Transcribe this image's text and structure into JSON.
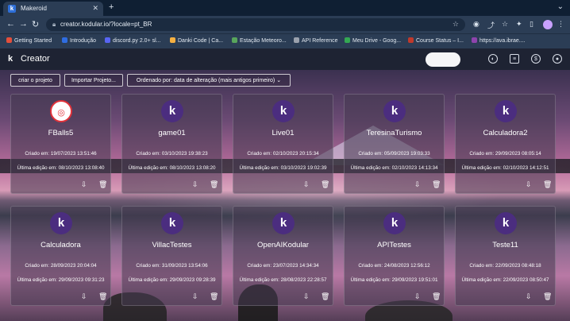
{
  "browser": {
    "tab_title": "Makeroid",
    "url": "creator.kodular.io/?locale=pt_BR",
    "bookmarks": [
      {
        "label": "Getting Started",
        "color": "#e34f3b"
      },
      {
        "label": "Introdução",
        "color": "#2f6de1"
      },
      {
        "label": "discord.py 2.0+ sl...",
        "color": "#5865f2"
      },
      {
        "label": "Danki Code | Ca...",
        "color": "#f5b041"
      },
      {
        "label": "Estação Meteoro...",
        "color": "#58a55c"
      },
      {
        "label": "API Reference",
        "color": "#9aa1ad"
      },
      {
        "label": "Meu Drive - Goog...",
        "color": "#34a853"
      },
      {
        "label": "Course Status – I...",
        "color": "#c0392b"
      },
      {
        "label": "https://ava.ibrae....",
        "color": "#8e44ad"
      }
    ]
  },
  "app": {
    "logo": "k",
    "title": "Creator"
  },
  "toolbar": {
    "create_label": "criar o projeto",
    "import_label": "Importar Projeto...",
    "sort_label": "Ordenado por: data de alteração (mais antigos primeiro)"
  },
  "projects": [
    {
      "name": "FBalls5",
      "created": "Criado em: 19/07/2023 13:51:46",
      "edited": "Última edição em: 08/10/2023 13:08:40"
    },
    {
      "name": "game01",
      "created": "Criado em: 03/10/2023 19:38:23",
      "edited": "Última edição em: 08/10/2023 13:08:20"
    },
    {
      "name": "Live01",
      "created": "Criado em: 02/10/2023 20:15:34",
      "edited": "Última edição em: 03/10/2023 19:02:39"
    },
    {
      "name": "TeresinaTurismo",
      "created": "Criado em: 05/09/2023 19:03:33",
      "edited": "Última edição em: 02/10/2023 14:13:34"
    },
    {
      "name": "Calculadora2",
      "created": "Criado em: 29/09/2023 08:05:14",
      "edited": "Última edição em: 02/10/2023 14:12:51"
    },
    {
      "name": "Calculadora",
      "created": "Criado em: 28/09/2023 20:04:04",
      "edited": "Última edição em: 29/09/2023 09:31:23"
    },
    {
      "name": "VillacTestes",
      "created": "Criado em: 31/09/2023 13:54:06",
      "edited": "Última edição em: 29/09/2023 09:28:39"
    },
    {
      "name": "OpenAIKodular",
      "created": "Criado em: 23/07/2023 14:34:34",
      "edited": "Última edição em: 28/08/2023 22:28:57"
    },
    {
      "name": "APITestes",
      "created": "Criado em: 24/08/2023 12:56:12",
      "edited": "Última edição em: 29/09/2023 19:51:01"
    },
    {
      "name": "Teste11",
      "created": "Criado em: 22/09/2023 08:48:18",
      "edited": "Última edição em: 22/09/2023 08:50:47"
    }
  ],
  "icons": {
    "kodular_letter": "k",
    "download": "download-icon",
    "delete": "trash-icon"
  }
}
